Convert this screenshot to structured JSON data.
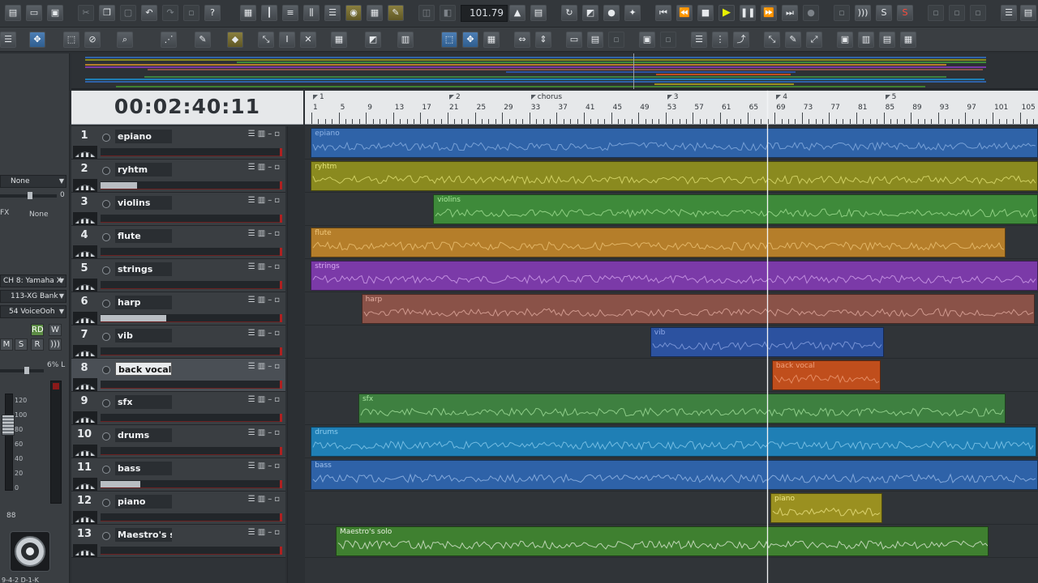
{
  "tempo": "101.79",
  "time_display": "00:02:40:11",
  "inspector": {
    "input": "None",
    "pan_value": "0",
    "fx_label": "FX",
    "fx_value": "None",
    "channel": "CH 8: Yamaha X",
    "bank": "113-XG Bank",
    "patch": "54 VoiceOoh",
    "rd": "RD",
    "w": "W",
    "m": "M",
    "s": "S",
    "r": "R",
    "pan_readout": "6% L",
    "volume_readout": "88",
    "scale": [
      "120",
      "100",
      "80",
      "60",
      "40",
      "20",
      "0"
    ],
    "bottom_text": "9-4-2 D-1-K"
  },
  "ruler": {
    "markers": [
      {
        "label": "1",
        "bar": 1
      },
      {
        "label": "2",
        "bar": 21
      },
      {
        "label": "chorus",
        "bar": 33
      },
      {
        "label": "3",
        "bar": 53
      },
      {
        "label": "4",
        "bar": 69
      },
      {
        "label": "5",
        "bar": 85
      }
    ],
    "numbers": [
      "1",
      "5",
      "9",
      "13",
      "17",
      "21",
      "25",
      "29",
      "33",
      "37",
      "41",
      "45",
      "49",
      "53",
      "57",
      "61",
      "65",
      "69",
      "73",
      "77",
      "81",
      "85",
      "89",
      "93",
      "97",
      "101",
      "105"
    ]
  },
  "tracks": [
    {
      "num": "1",
      "name": "epiano",
      "color": "#2f63a8",
      "label_color": "#8fb4e6",
      "vol": 0.0
    },
    {
      "num": "2",
      "name": "ryhtm",
      "color": "#8a8a1f",
      "label_color": "#e6e67a",
      "vol": 0.2
    },
    {
      "num": "3",
      "name": "violins",
      "color": "#3e8a3a",
      "label_color": "#a8e69a",
      "vol": 0.0
    },
    {
      "num": "4",
      "name": "flute",
      "color": "#b57e2a",
      "label_color": "#f0c77a",
      "vol": 0.0
    },
    {
      "num": "5",
      "name": "strings",
      "color": "#7b3aa8",
      "label_color": "#d7a8f0",
      "vol": 0.0
    },
    {
      "num": "6",
      "name": "harp",
      "color": "#8a5248",
      "label_color": "#e6b0a4",
      "vol": 0.36
    },
    {
      "num": "7",
      "name": "vib",
      "color": "#2c52a0",
      "label_color": "#8fa8e6",
      "vol": 0.0
    },
    {
      "num": "8",
      "name": "back vocal",
      "color": "#c04e1c",
      "label_color": "#f0a07a",
      "vol": 0.0
    },
    {
      "num": "9",
      "name": "sfx",
      "color": "#3e8040",
      "label_color": "#a8e6a0",
      "vol": 0.0
    },
    {
      "num": "10",
      "name": "drums",
      "color": "#1f7fb5",
      "label_color": "#8fcff0",
      "vol": 0.0
    },
    {
      "num": "11",
      "name": "bass",
      "color": "#2e62a8",
      "label_color": "#9fc0ec",
      "vol": 0.22
    },
    {
      "num": "12",
      "name": "piano",
      "color": "#9a9020",
      "label_color": "#f0e88a",
      "vol": 0.0
    },
    {
      "num": "13",
      "name": "Maestro's solo",
      "color": "#3f8030",
      "label_color": "#e8f0e0",
      "vol": 0.0
    }
  ],
  "clips": [
    {
      "track": 0,
      "name": "epiano",
      "start": 0.8,
      "end": 100
    },
    {
      "track": 1,
      "name": "ryhtm",
      "start": 0.8,
      "end": 100
    },
    {
      "track": 2,
      "name": "violins",
      "start": 17.5,
      "end": 100
    },
    {
      "track": 3,
      "name": "flute",
      "start": 0.8,
      "end": 95.6
    },
    {
      "track": 4,
      "name": "strings",
      "start": 0.8,
      "end": 100
    },
    {
      "track": 5,
      "name": "harp",
      "start": 7.7,
      "end": 99.6
    },
    {
      "track": 6,
      "name": "vib",
      "start": 47.1,
      "end": 79.0
    },
    {
      "track": 7,
      "name": "back vocal",
      "start": 63.7,
      "end": 78.5
    },
    {
      "track": 8,
      "name": "sfx",
      "start": 7.3,
      "end": 95.6
    },
    {
      "track": 9,
      "name": "drums",
      "start": 0.8,
      "end": 99.8
    },
    {
      "track": 10,
      "name": "bass",
      "start": 0.8,
      "end": 100
    },
    {
      "track": 11,
      "name": "piano",
      "start": 63.5,
      "end": 78.8
    },
    {
      "track": 12,
      "name": "Maestro's solo",
      "start": 4.2,
      "end": 93.3
    }
  ],
  "selected_track": 7
}
